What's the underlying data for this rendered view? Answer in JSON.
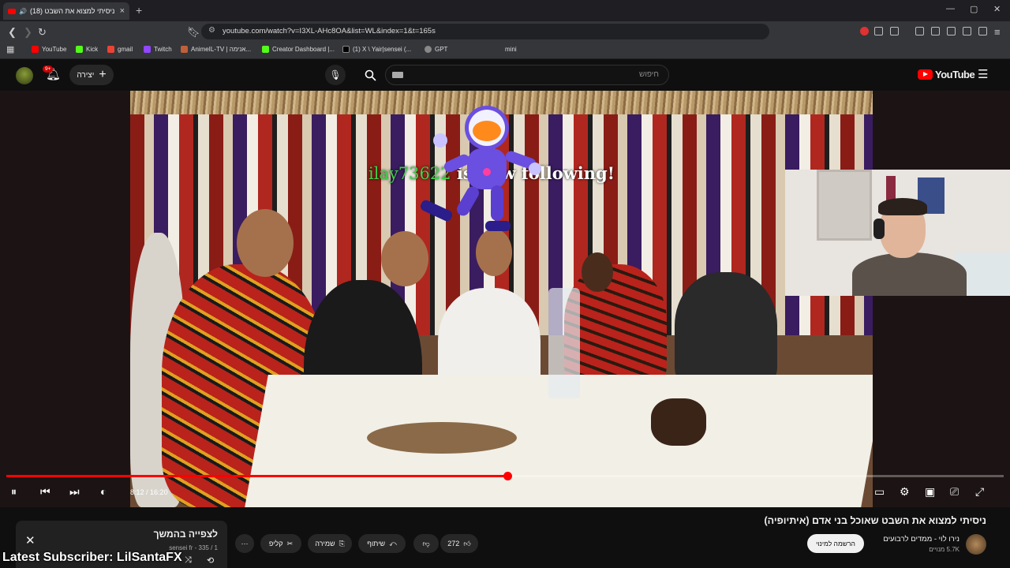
{
  "browser": {
    "tab_title": "(18) ניסיתי למצוא את השבט",
    "url": "youtube.com/watch?v=I3XL-AHc8OA&list=WL&index=1&t=165s",
    "bookmarks": [
      "YouTube",
      "Kick",
      "gmail",
      "Twitch",
      "AnimeIL-TV | אנימה...",
      "Creator Dashboard |...",
      "(1) X \\ Yair|sensei (...",
      "GPT",
      "mini"
    ],
    "window_controls": [
      "—",
      "▢",
      "✕"
    ]
  },
  "youtube_header": {
    "notification_count": "9+",
    "create_label": "יצירה",
    "search_placeholder": "חיפוש",
    "logo_text": "YouTube"
  },
  "stream_overlay": {
    "follower_name": "ilay73622",
    "follow_text": " is now following!",
    "latest_subscriber": "Latest Subscriber: LilSantaFX"
  },
  "player": {
    "time_current": "8:12",
    "time_separator": " / ",
    "time_total": "16:20",
    "progress": 0.502
  },
  "video_info": {
    "title": "ניסיתי למצוא את השבט שאוכל בני אדם (איתיופיה)",
    "channel_name": "נירו לוי - ממדים לרבועים",
    "subscribers": "5.7K מנויים",
    "subscribe_label": "הרשמה למינוי",
    "like_count": "272",
    "share_label": "שיתוף",
    "save_label": "שמירה",
    "clip_label": "קליפ"
  },
  "queue": {
    "title": "לצפייה בהמשך",
    "subtitle": "sensei fr - 335 / 1"
  },
  "colors": {
    "accent": "#ff0000",
    "follow_green": "#3fd04a"
  }
}
